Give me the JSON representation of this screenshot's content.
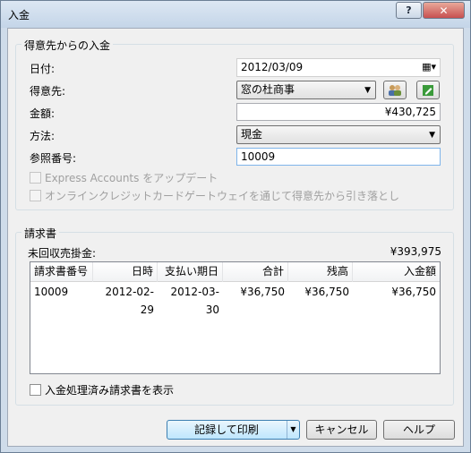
{
  "window": {
    "title": "入金",
    "help_glyph": "?",
    "close_glyph": "✕"
  },
  "customer_group": {
    "title": "得意先からの入金",
    "date_label": "日付:",
    "date_value": "2012/03/09",
    "customer_label": "得意先:",
    "customer_value": "窓の杜商事",
    "amount_label": "金額:",
    "amount_value": "¥430,725",
    "method_label": "方法:",
    "method_value": "現金",
    "reference_label": "参照番号:",
    "reference_value": "10009",
    "express_checkbox_label": "Express Accounts をアップデート",
    "gateway_checkbox_label": "オンラインクレジットカードゲートウェイを通じて得意先から引き落とし"
  },
  "invoice_group": {
    "title": "請求書",
    "outstanding_label": "未回収売掛金:",
    "outstanding_value": "¥393,975",
    "columns": [
      "請求書番号",
      "日時",
      "支払い期日",
      "合計",
      "残高",
      "入金額"
    ],
    "rows": [
      {
        "number": "10009",
        "date": "2012-02-29",
        "due": "2012-03-30",
        "total": "¥36,750",
        "balance": "¥36,750",
        "payment": "¥36,750"
      }
    ],
    "show_processed_label": "入金処理済み請求書を表示"
  },
  "buttons": {
    "record_print": "記録して印刷",
    "cancel": "キャンセル",
    "help": "ヘルプ"
  }
}
